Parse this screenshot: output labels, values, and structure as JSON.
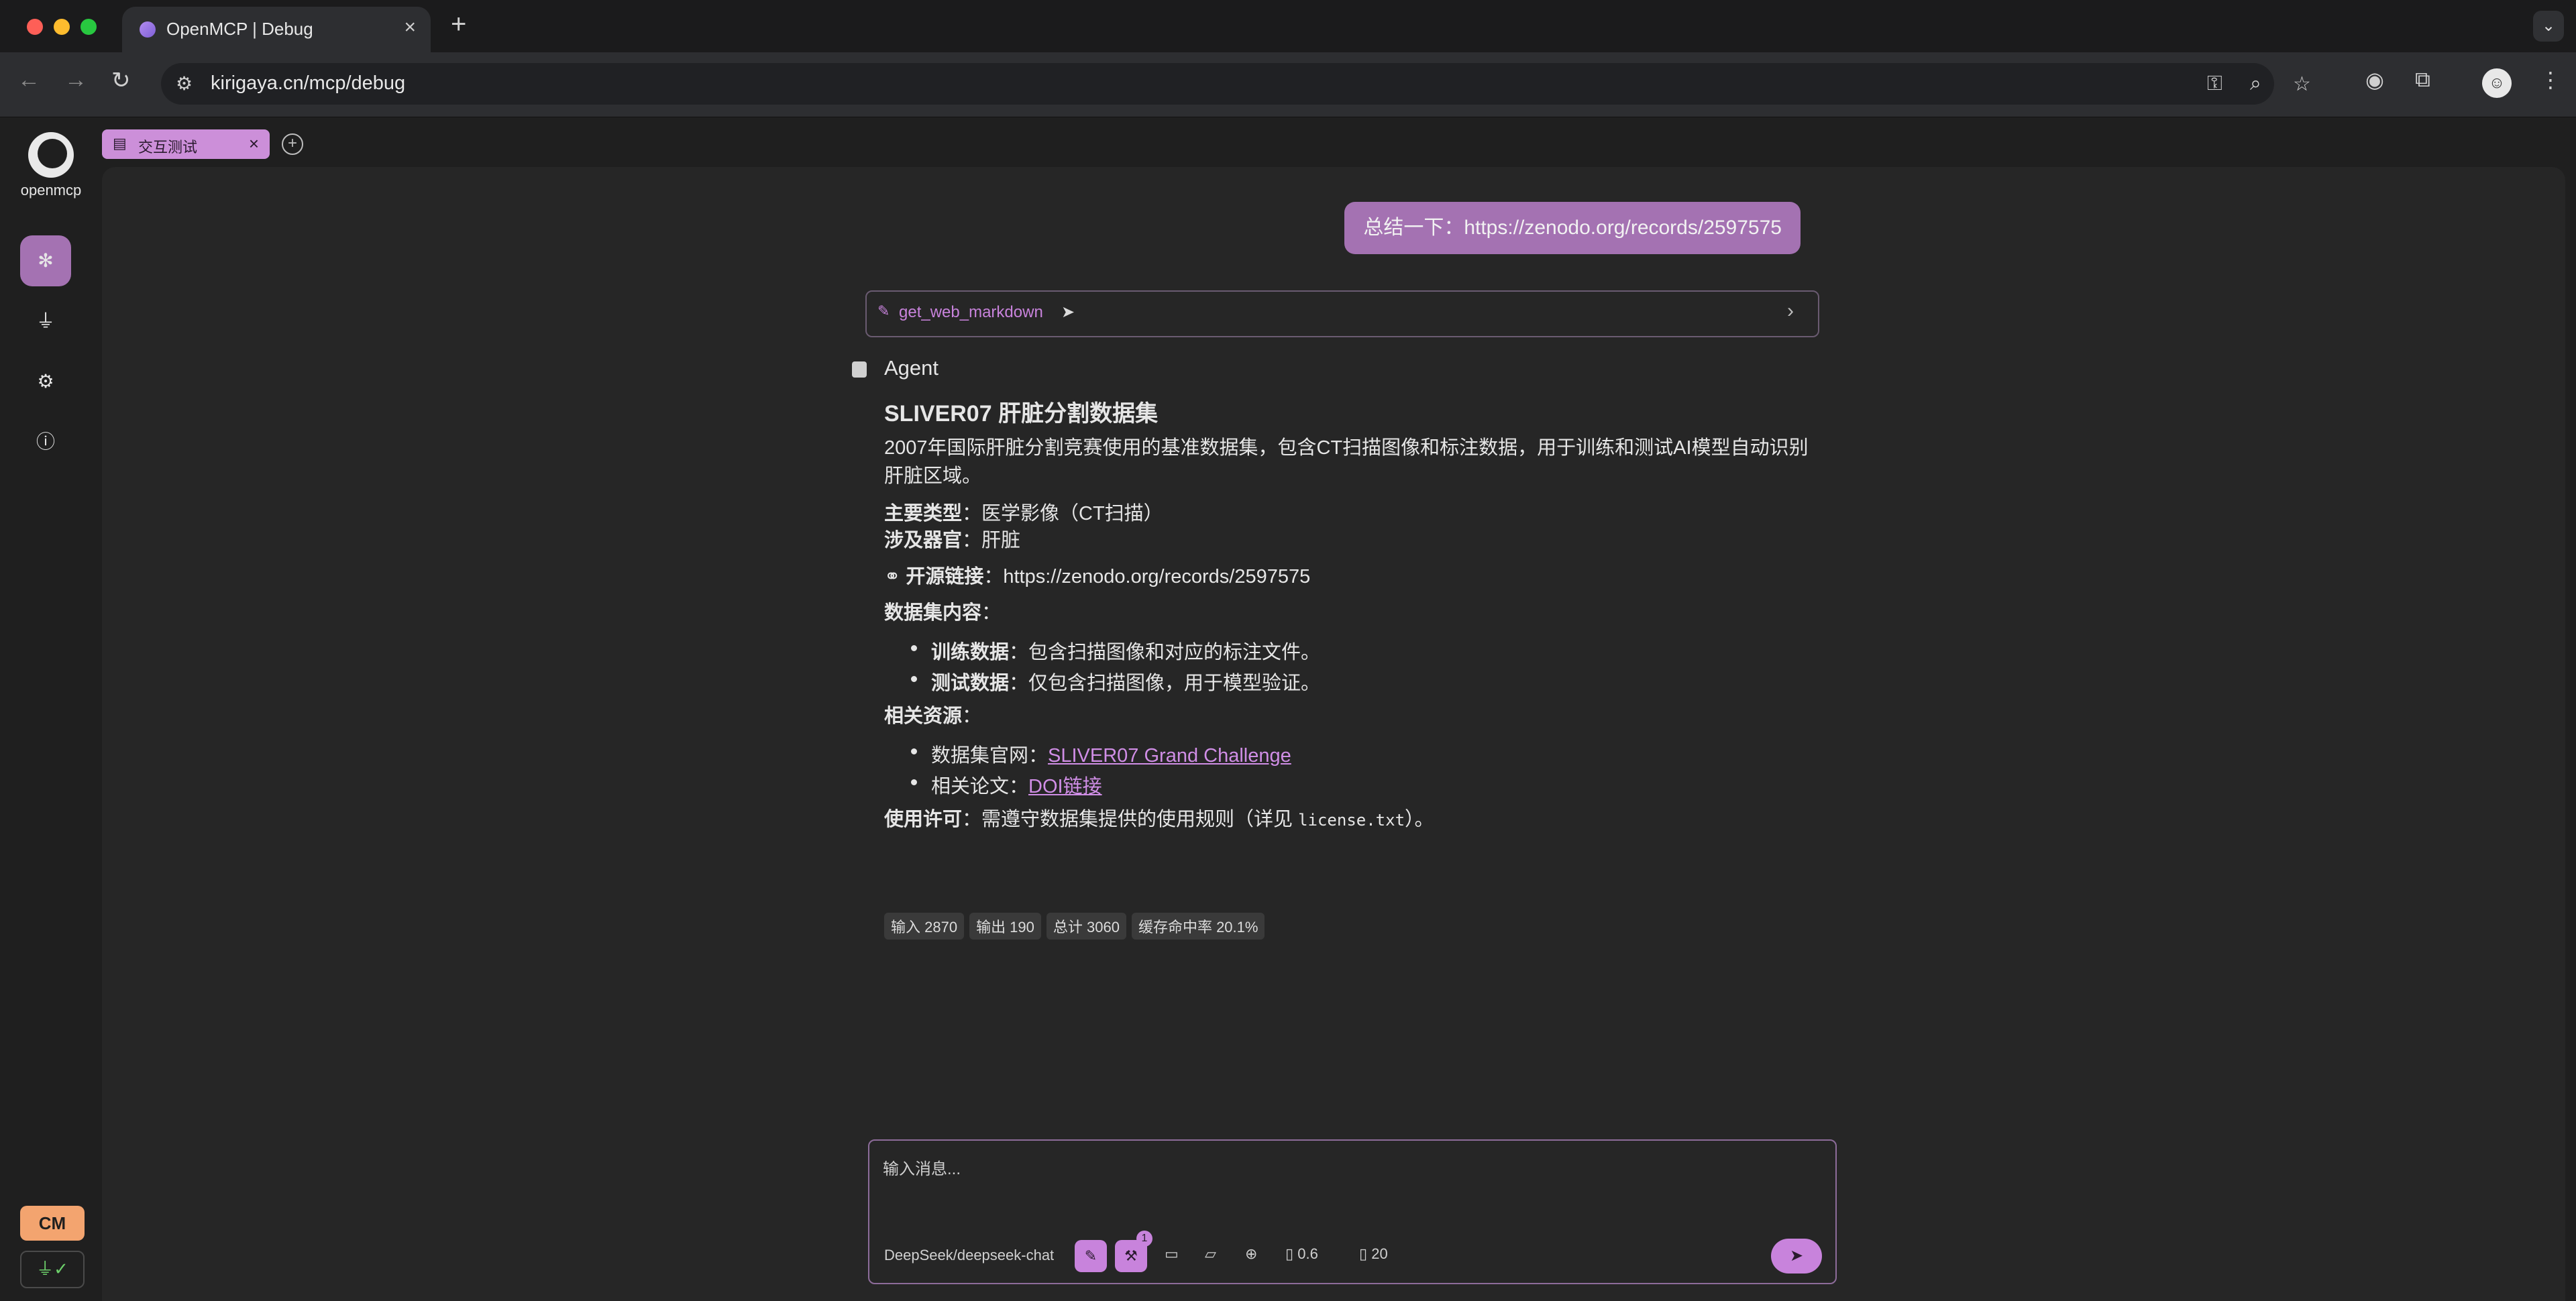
{
  "browser": {
    "tab_title": "OpenMCP | Debug",
    "url": "kirigaya.cn/mcp/debug"
  },
  "sidebar": {
    "logo_text": "openmcp",
    "items": [
      {
        "name": "debug",
        "icon": "bug-icon"
      },
      {
        "name": "connection",
        "icon": "plug-icon"
      },
      {
        "name": "settings",
        "icon": "gear-icon"
      },
      {
        "name": "about",
        "icon": "info-icon"
      }
    ],
    "badge": "CM"
  },
  "tabs": [
    {
      "label": "交互测试"
    }
  ],
  "chat": {
    "user_message": "总结一下：https://zenodo.org/records/2597575",
    "tool_call_name": "get_web_markdown",
    "agent_label": "Agent",
    "title": "SLIVER07 肝脏分割数据集",
    "intro": "2007年国际肝脏分割竞赛使用的基准数据集，包含CT扫描图像和标注数据，用于训练和测试AI模型自动识别肝脏区域。",
    "type_label": "主要类型",
    "type_value": "：医学影像（CT扫描）",
    "organ_label": "涉及器官",
    "organ_value": "：肝脏",
    "link_label": "开源链接",
    "link_value": "：https://zenodo.org/records/2597575",
    "contents_label": "数据集内容",
    "colon": "：",
    "train_label": "训练数据",
    "train_value": "：包含扫描图像和对应的标注文件。",
    "test_label": "测试数据",
    "test_value": "：仅包含扫描图像，用于模型验证。",
    "resources_label": "相关资源",
    "site_label": "数据集官网：",
    "site_link": "SLIVER07 Grand Challenge",
    "paper_label": "相关论文：",
    "paper_link": "DOI链接",
    "license_label": "使用许可",
    "license_value": "：需遵守数据集提供的使用规则（详见 ",
    "license_file": "license.txt",
    "license_end": "）。",
    "usage": [
      "输入 2870",
      "输出 190",
      "总计 3060",
      "缓存命中率 20.1%"
    ]
  },
  "composer": {
    "placeholder": "输入消息...",
    "model": "DeepSeek/deepseek-chat",
    "tool_badge": "1",
    "temperature": "0.6",
    "context": "20"
  }
}
